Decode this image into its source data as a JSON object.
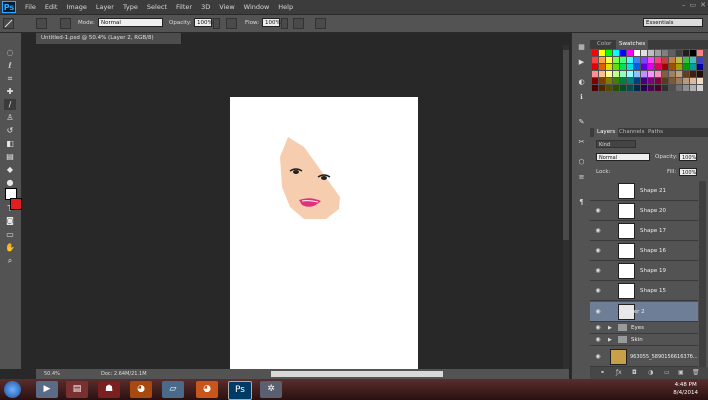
{
  "app": {
    "logo": "Ps"
  },
  "menu": [
    "File",
    "Edit",
    "Image",
    "Layer",
    "Type",
    "Select",
    "Filter",
    "3D",
    "View",
    "Window",
    "Help"
  ],
  "window_controls": [
    "–",
    "▭",
    "✕"
  ],
  "options": {
    "mode_label": "Mode:",
    "mode_value": "Normal",
    "opacity_label": "Opacity:",
    "opacity_value": "100%",
    "flow_label": "Flow:",
    "flow_value": "100%",
    "workspace": "Essentials"
  },
  "document": {
    "tab_title": "Untitled-1.psd @ 50.4% (Layer 2, RGB/8)",
    "zoom": "50.4%",
    "doc_info": "Doc: 2.64M/21.1M"
  },
  "panels": {
    "color_tabs": [
      "Color",
      "Swatches"
    ],
    "layers_tabs": [
      "Layers",
      "Channels",
      "Paths"
    ],
    "kind_label": "Kind",
    "blend_mode": "Normal",
    "opacity_label": "Opacity:",
    "opacity_value": "100%",
    "lock_label": "Lock:",
    "fill_label": "Fill:",
    "fill_value": "100%"
  },
  "layers": [
    {
      "name": "Shape 21"
    },
    {
      "name": "Shape 20"
    },
    {
      "name": "Shape 17"
    },
    {
      "name": "Shape 16"
    },
    {
      "name": "Shape 19"
    },
    {
      "name": "Shape 15"
    },
    {
      "name": "Layer 2",
      "selected": true
    }
  ],
  "groups": [
    {
      "name": "Eyes"
    },
    {
      "name": "Skin"
    }
  ],
  "bottom_layer": {
    "name": "963055_589015661637б..."
  },
  "taskbar": {
    "time": "4:48 PM",
    "date": "8/4/2014"
  },
  "colors": {
    "skin": "#f7cdb0",
    "lips": "#e0327a",
    "selection": "#6e7e96"
  }
}
